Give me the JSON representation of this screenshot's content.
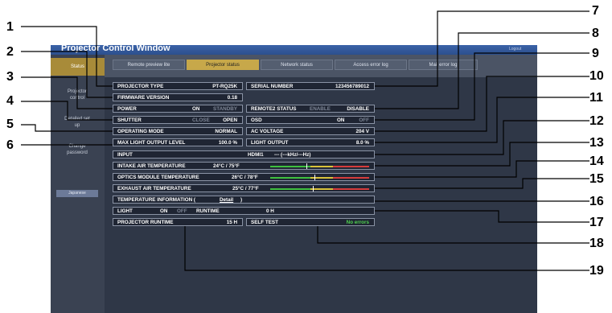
{
  "window": {
    "title": "Projector Control Window",
    "logout": "Logout"
  },
  "tabs": [
    "Remote preview lite",
    "Projector status",
    "Network status",
    "Access error log",
    "Mail error log"
  ],
  "sidebar": {
    "items": [
      "Status",
      "Projector control",
      "Detailed set up",
      "Change password"
    ],
    "language": "Japanese"
  },
  "status": {
    "projector_type_label": "PROJECTOR TYPE",
    "projector_type": "PT-RQ25K",
    "firmware_label": "FIRMWARE VERSION",
    "firmware": "0.18",
    "power_label": "POWER",
    "power_on": "ON",
    "power_standby": "STANDBY",
    "shutter_label": "SHUTTER",
    "shutter_close": "CLOSE",
    "shutter_open": "OPEN",
    "operating_label": "OPERATING MODE",
    "operating": "NORMAL",
    "max_light_label": "MAX LIGHT OUTPUT LEVEL",
    "max_light": "100.0 %",
    "serial_label": "SERIAL NUMBER",
    "serial": "123456789012",
    "remote2_label": "REMOTE2 STATUS",
    "remote2_enable": "ENABLE",
    "remote2_disable": "DISABLE",
    "osd_label": "OSD",
    "osd_on": "ON",
    "osd_off": "OFF",
    "ac_label": "AC VOLTAGE",
    "ac": "204 V",
    "light_output_label": "LIGHT OUTPUT",
    "light_output": "8.0 %",
    "input_label": "INPUT",
    "input": "HDMI1",
    "input_freq": "--- (---kHz/---Hz)",
    "intake_label": "INTAKE AIR TEMPERATURE",
    "intake": "24°C / 75°F",
    "optics_label": "OPTICS MODULE TEMPERATURE",
    "optics": "26°C / 78°F",
    "exhaust_label": "EXHAUST AIR TEMPERATURE",
    "exhaust": "25°C / 77°F",
    "temp_info_label": "TEMPERATURE INFORMATION (",
    "temp_info_link": "Detail",
    "temp_info_close": ")",
    "light_label": "LIGHT",
    "light_on": "ON",
    "light_off": "OFF",
    "runtime_label": "RUNTIME",
    "runtime": "0 H",
    "proj_runtime_label": "PROJECTOR RUNTIME",
    "proj_runtime": "15 H",
    "self_test_label": "SELF TEST",
    "self_test": "No errors"
  },
  "callouts": [
    "1",
    "2",
    "3",
    "4",
    "5",
    "6",
    "7",
    "8",
    "9",
    "10",
    "11",
    "12",
    "13",
    "14",
    "15",
    "16",
    "17",
    "18",
    "19"
  ],
  "colors": {
    "accent": "#c7a84a",
    "ok": "#4fd24f",
    "title_bar": "#2c4f8d"
  }
}
